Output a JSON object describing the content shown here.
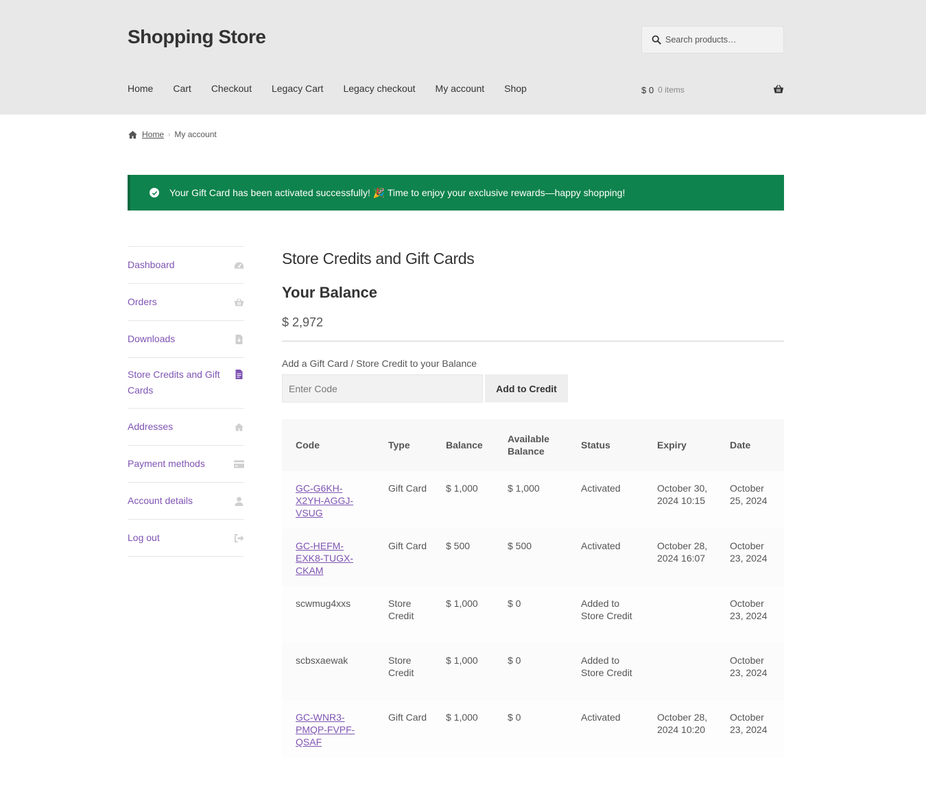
{
  "header": {
    "site_title": "Shopping Store",
    "search_placeholder": "Search products…",
    "nav": [
      "Home",
      "Cart",
      "Checkout",
      "Legacy Cart",
      "Legacy checkout",
      "My account",
      "Shop"
    ],
    "cart_amount": "$ 0",
    "cart_count": "0 items"
  },
  "breadcrumb": {
    "home": "Home",
    "current": "My account"
  },
  "notice": {
    "text": "Your Gift Card has been activated successfully! 🎉 Time to enjoy your exclusive rewards—happy shopping!",
    "color": "#0f834d"
  },
  "account_nav": [
    {
      "label": "Dashboard",
      "icon": "dashboard-icon"
    },
    {
      "label": "Orders",
      "icon": "basket-icon"
    },
    {
      "label": "Downloads",
      "icon": "file-download-icon"
    },
    {
      "label": "Store Credits and Gift Cards",
      "icon": "file-text-icon",
      "active": true
    },
    {
      "label": "Addresses",
      "icon": "home-icon"
    },
    {
      "label": "Payment methods",
      "icon": "credit-card-icon"
    },
    {
      "label": "Account details",
      "icon": "user-icon"
    },
    {
      "label": "Log out",
      "icon": "sign-out-icon"
    }
  ],
  "main": {
    "title": "Store Credits and Gift Cards",
    "balance_heading": "Your Balance",
    "balance_value": "$ 2,972",
    "add_label": "Add a Gift Card / Store Credit to your Balance",
    "code_placeholder": "Enter Code",
    "add_button": "Add to Credit",
    "accent_color": "#7f54b3"
  },
  "table": {
    "headers": [
      "Code",
      "Type",
      "Balance",
      "Available Balance",
      "Status",
      "Expiry",
      "Date"
    ],
    "rows": [
      {
        "code": "GC-G6KH-X2YH-AGGJ-VSUG",
        "linked": true,
        "type": "Gift Card",
        "balance": "$ 1,000",
        "available": "$ 1,000",
        "status": "Activated",
        "expiry": "October 30, 2024 10:15",
        "date": "October 25, 2024"
      },
      {
        "code": "GC-HEFM-EXK8-TUGX-CKAM",
        "linked": true,
        "type": "Gift Card",
        "balance": "$ 500",
        "available": "$ 500",
        "status": "Activated",
        "expiry": "October 28, 2024 16:07",
        "date": "October 23, 2024"
      },
      {
        "code": "scwmug4xxs",
        "linked": false,
        "type": "Store Credit",
        "balance": "$ 1,000",
        "available": "$ 0",
        "status": "Added to Store Credit",
        "expiry": "",
        "date": "October 23, 2024"
      },
      {
        "code": "scbsxaewak",
        "linked": false,
        "type": "Store Credit",
        "balance": "$ 1,000",
        "available": "$ 0",
        "status": "Added to Store Credit",
        "expiry": "",
        "date": "October 23, 2024"
      },
      {
        "code": "GC-WNR3-PMQP-FVPF-QSAF",
        "linked": true,
        "type": "Gift Card",
        "balance": "$ 1,000",
        "available": "$ 0",
        "status": "Activated",
        "expiry": "October 28, 2024 10:20",
        "date": "October 23, 2024"
      }
    ]
  }
}
